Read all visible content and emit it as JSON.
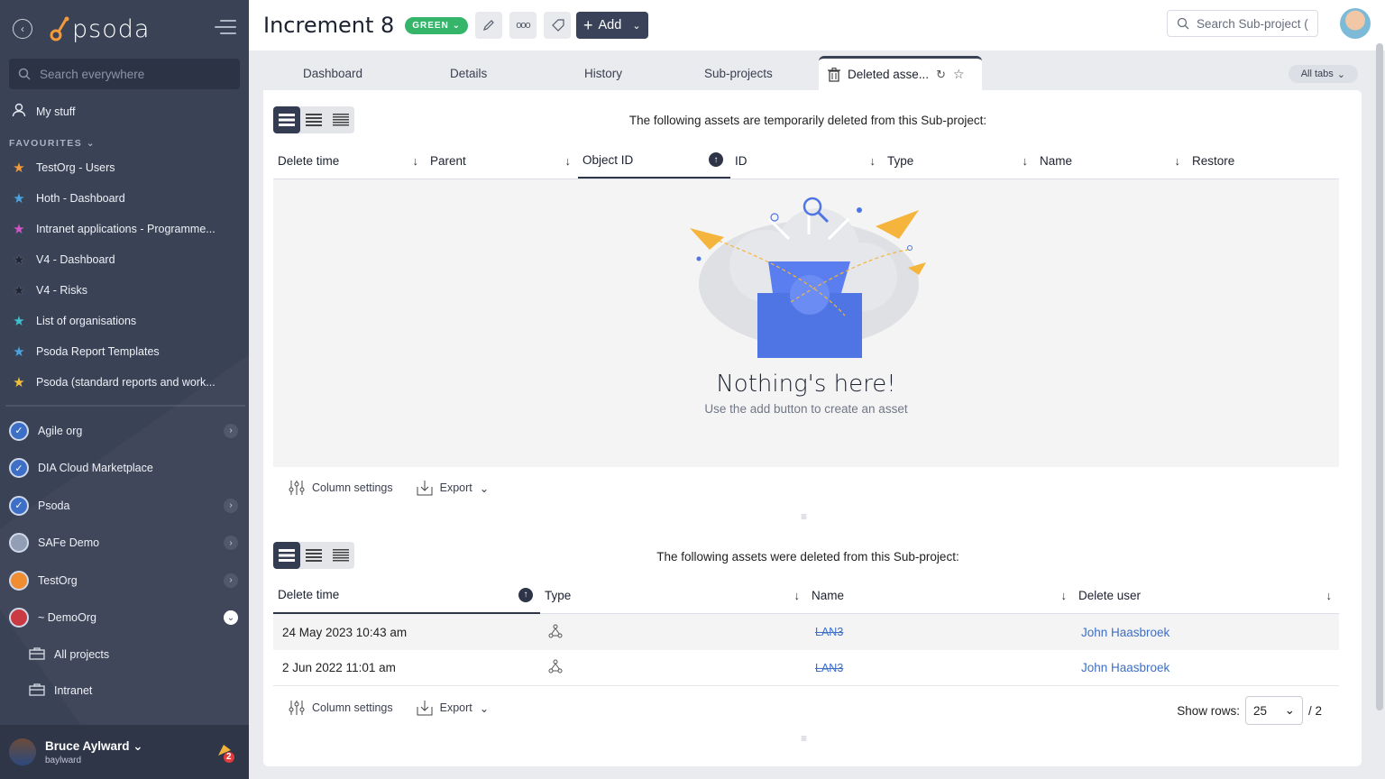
{
  "sidebar": {
    "logo_text": "psoda",
    "search_placeholder": "Search everywhere",
    "my_stuff": "My stuff",
    "favourites_label": "FAVOURITES",
    "favourites": [
      {
        "label": "TestOrg - Users",
        "color": "#f39a3b"
      },
      {
        "label": "Hoth - Dashboard",
        "color": "#4aa3df"
      },
      {
        "label": "Intranet applications - Programme...",
        "color": "#d155c6"
      },
      {
        "label": "V4 - Dashboard",
        "color": "#1f2433"
      },
      {
        "label": "V4 - Risks",
        "color": "#1f2433"
      },
      {
        "label": "List of organisations",
        "color": "#3fc1d0"
      },
      {
        "label": "Psoda Report Templates",
        "color": "#4aa3df"
      },
      {
        "label": "Psoda (standard reports and work...",
        "color": "#f2c13b"
      }
    ],
    "orgs": [
      {
        "label": "Agile org",
        "expandable": true
      },
      {
        "label": "DIA Cloud Marketplace",
        "expandable": false
      },
      {
        "label": "Psoda",
        "expandable": true
      },
      {
        "label": "SAFe Demo",
        "expandable": true
      },
      {
        "label": "TestOrg",
        "expandable": true
      },
      {
        "label": "~ DemoOrg",
        "expandable": true
      }
    ],
    "sub_items": [
      "All projects",
      "Intranet"
    ],
    "user": {
      "name": "Bruce Aylward",
      "handle": "baylward",
      "notifications": "2"
    }
  },
  "header": {
    "title": "Increment 8",
    "status": "GREEN",
    "add_label": "Add",
    "search_placeholder": "Search Sub-project (",
    "accent": "#394259",
    "status_color": "#34b56a"
  },
  "tabs": {
    "items": [
      "Dashboard",
      "Details",
      "History",
      "Sub-projects"
    ],
    "active": "Deleted asse...",
    "all_tabs": "All tabs"
  },
  "temp_deleted": {
    "caption": "The following assets are temporarily deleted from this Sub-project:",
    "columns": [
      "Delete time",
      "Parent",
      "Object ID",
      "ID",
      "Type",
      "Name",
      "Restore"
    ],
    "empty_title": "Nothing's here!",
    "empty_sub": "Use the add button to create an asset",
    "column_settings": "Column settings",
    "export": "Export"
  },
  "deleted": {
    "caption": "The following assets were deleted from this Sub-project:",
    "columns": [
      "Delete time",
      "Type",
      "Name",
      "Delete user"
    ],
    "rows": [
      {
        "delete_time": "24 May 2023 10:43 am",
        "name": "LAN3",
        "user": "John Haasbroek"
      },
      {
        "delete_time": "2 Jun 2022 11:01 am",
        "name": "LAN3",
        "user": "John Haasbroek"
      }
    ],
    "column_settings": "Column settings",
    "export": "Export",
    "show_rows_label": "Show rows:",
    "show_rows_value": "25",
    "pages": "/ 2"
  }
}
